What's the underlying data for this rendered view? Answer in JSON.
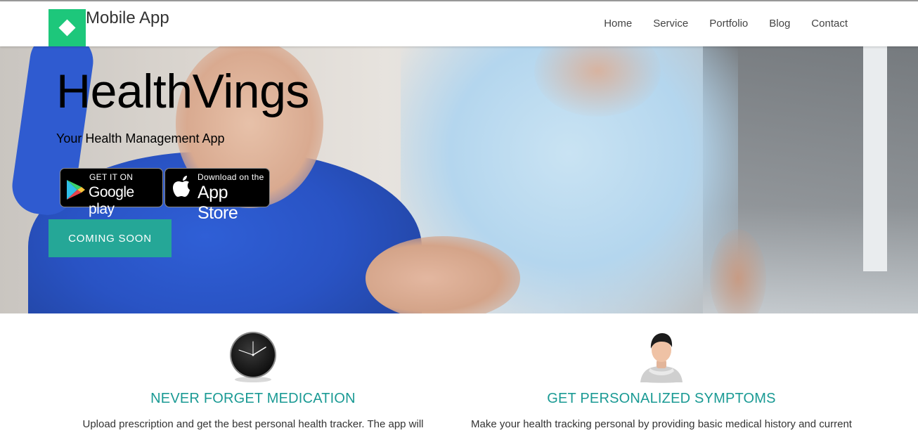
{
  "header": {
    "brand": "Mobile App",
    "logo_icon": "diamond-icon",
    "nav": [
      "Home",
      "Service",
      "Portfolio",
      "Blog",
      "Contact"
    ]
  },
  "hero": {
    "title": "HealthVings",
    "subtitle": "Your Health Management App",
    "google_badge": {
      "small": "GET IT ON",
      "big": "Google play",
      "icon": "google-play-icon"
    },
    "apple_badge": {
      "small": "Download on the",
      "big": "App Store",
      "icon": "apple-icon"
    },
    "cta": "COMING SOON"
  },
  "features": [
    {
      "icon": "clock-icon",
      "title": "NEVER FORGET MEDICATION",
      "text": "Upload prescription and get the best personal health tracker. The app will"
    },
    {
      "icon": "user-avatar-icon",
      "title": "GET PERSONALIZED SYMPTOMS",
      "text": "Make your health tracking personal by providing basic medical history and current"
    }
  ],
  "colors": {
    "brand_green": "#1dc77b",
    "cta_teal": "#25a797",
    "feature_title": "#1a9a94"
  }
}
